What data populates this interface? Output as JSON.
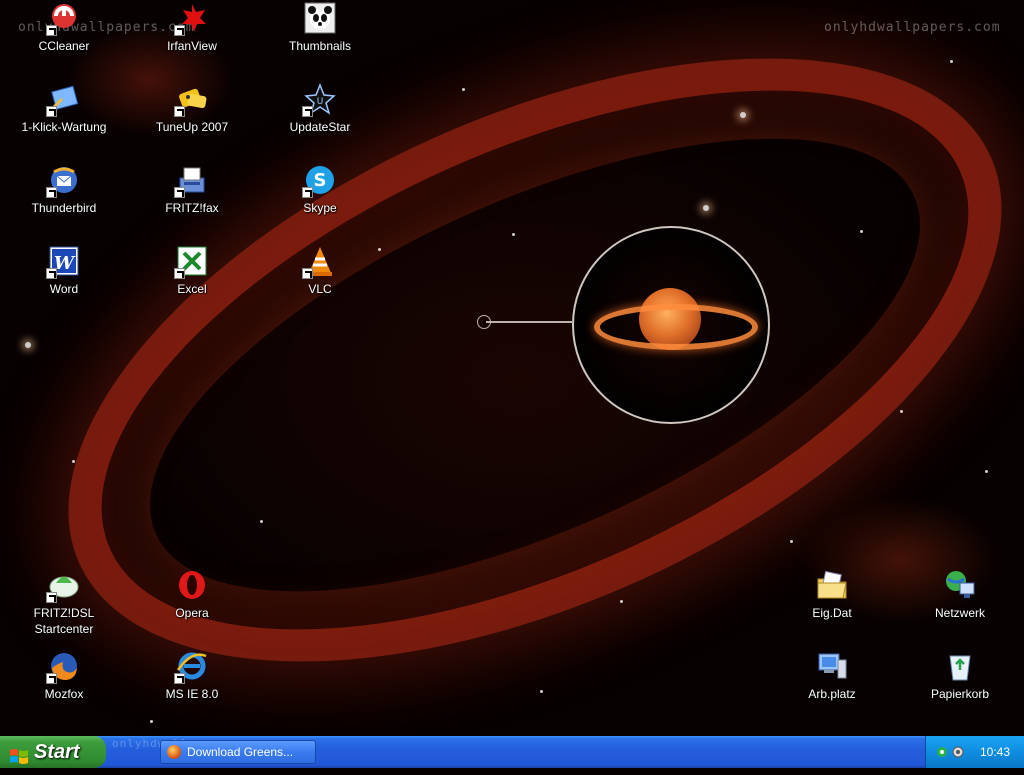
{
  "wallpaper": {
    "watermark_left": "onlyhdwallpapers.com",
    "watermark_right": "onlyhdwallpapers.com",
    "watermark_taskbar": "onlyhdwallpapers"
  },
  "desktop_icons": [
    {
      "label": "CCleaner"
    },
    {
      "label": "IrfanView"
    },
    {
      "label": "Thumbnails"
    },
    {
      "label": "1-Klick-Wartung"
    },
    {
      "label": "TuneUp 2007"
    },
    {
      "label": "UpdateStar"
    },
    {
      "label": "Thunderbird"
    },
    {
      "label": "FRITZ!fax"
    },
    {
      "label": "Skype"
    },
    {
      "label": "Word"
    },
    {
      "label": "Excel"
    },
    {
      "label": "VLC"
    },
    {
      "label": "FRITZ!DSL\nStartcenter"
    },
    {
      "label": "Opera"
    },
    {
      "label": "Mozfox"
    },
    {
      "label": "MS IE 8.0"
    },
    {
      "label": "Eig.Dat"
    },
    {
      "label": "Netzwerk"
    },
    {
      "label": "Arb.platz"
    },
    {
      "label": "Papierkorb"
    }
  ],
  "taskbar": {
    "start_label": "Start",
    "task_item": "Download Greens...",
    "clock": "10:43"
  },
  "colors": {
    "taskbar_blue": "#245ddb",
    "start_green": "#3c9c3c",
    "tray_blue": "#0f8de0"
  }
}
